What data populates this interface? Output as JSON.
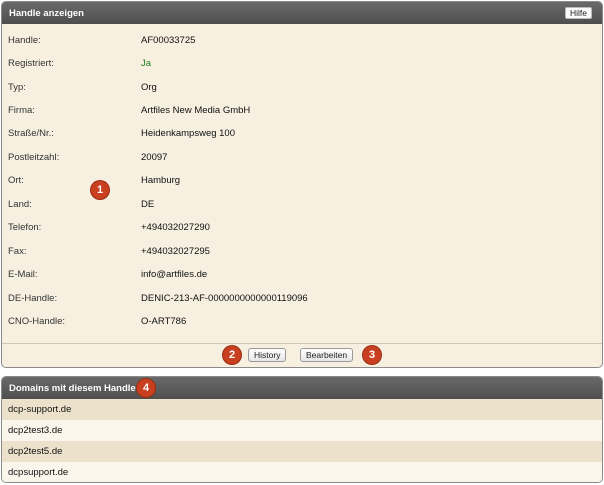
{
  "handle_panel": {
    "title": "Handle anzeigen",
    "help_label": "Hilfe",
    "fields": [
      {
        "label": "Handle:",
        "value": "AF00033725"
      },
      {
        "label": "Registriert:",
        "value": "Ja"
      },
      {
        "label": "Typ:",
        "value": "Org"
      },
      {
        "label": "Firma:",
        "value": "Artfiles New Media GmbH"
      },
      {
        "label": "Straße/Nr.:",
        "value": "Heidenkampsweg 100"
      },
      {
        "label": "Postleitzahl:",
        "value": "20097"
      },
      {
        "label": "Ort:",
        "value": "Hamburg"
      },
      {
        "label": "Land:",
        "value": "DE"
      },
      {
        "label": "Telefon:",
        "value": "+494032027290"
      },
      {
        "label": "Fax:",
        "value": "+494032027295"
      },
      {
        "label": "E-Mail:",
        "value": "info@artfiles.de"
      },
      {
        "label": "DE-Handle:",
        "value": "DENIC-213-AF-0000000000000119096"
      },
      {
        "label": "CNO-Handle:",
        "value": "O-ART786"
      }
    ],
    "buttons": {
      "history": "History",
      "edit": "Bearbeiten"
    }
  },
  "markers": {
    "m1": "1",
    "m2": "2",
    "m3": "3",
    "m4": "4"
  },
  "domains_panel": {
    "title": "Domains mit diesem Handle",
    "items": [
      "dcp-support.de",
      "dcp2test3.de",
      "dcp2test5.de",
      "dcpsupport.de"
    ]
  },
  "colors": {
    "header_bg": "#555555",
    "panel_bg": "#f7f0e1",
    "marker": "#c8401f",
    "registered_yes": "#1e7a1e"
  }
}
